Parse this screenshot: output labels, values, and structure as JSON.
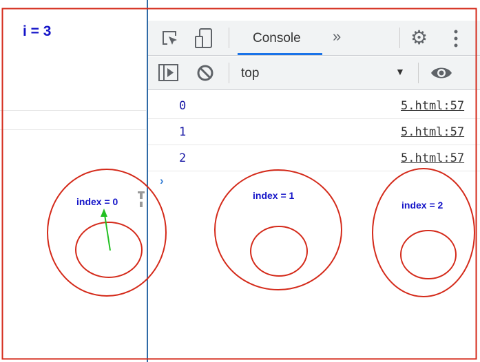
{
  "page": {
    "variable_label": "i = 3"
  },
  "devtools": {
    "tabs": [
      {
        "label": "Console",
        "active": true
      }
    ],
    "more_tabs_icon": "double-chevron-right",
    "context_select": {
      "value": "top"
    },
    "console_rows": [
      {
        "value": "0",
        "source": "5.html:57"
      },
      {
        "value": "1",
        "source": "5.html:57"
      },
      {
        "value": "2",
        "source": "5.html:57"
      }
    ]
  },
  "annotations": {
    "index_labels": [
      "index = 0",
      "index = 1",
      "index = 2"
    ],
    "colors": {
      "ellipse": "#d42a1a",
      "label": "#1414c8",
      "arrow": "#22c022",
      "frame": "#d42a1a"
    }
  }
}
